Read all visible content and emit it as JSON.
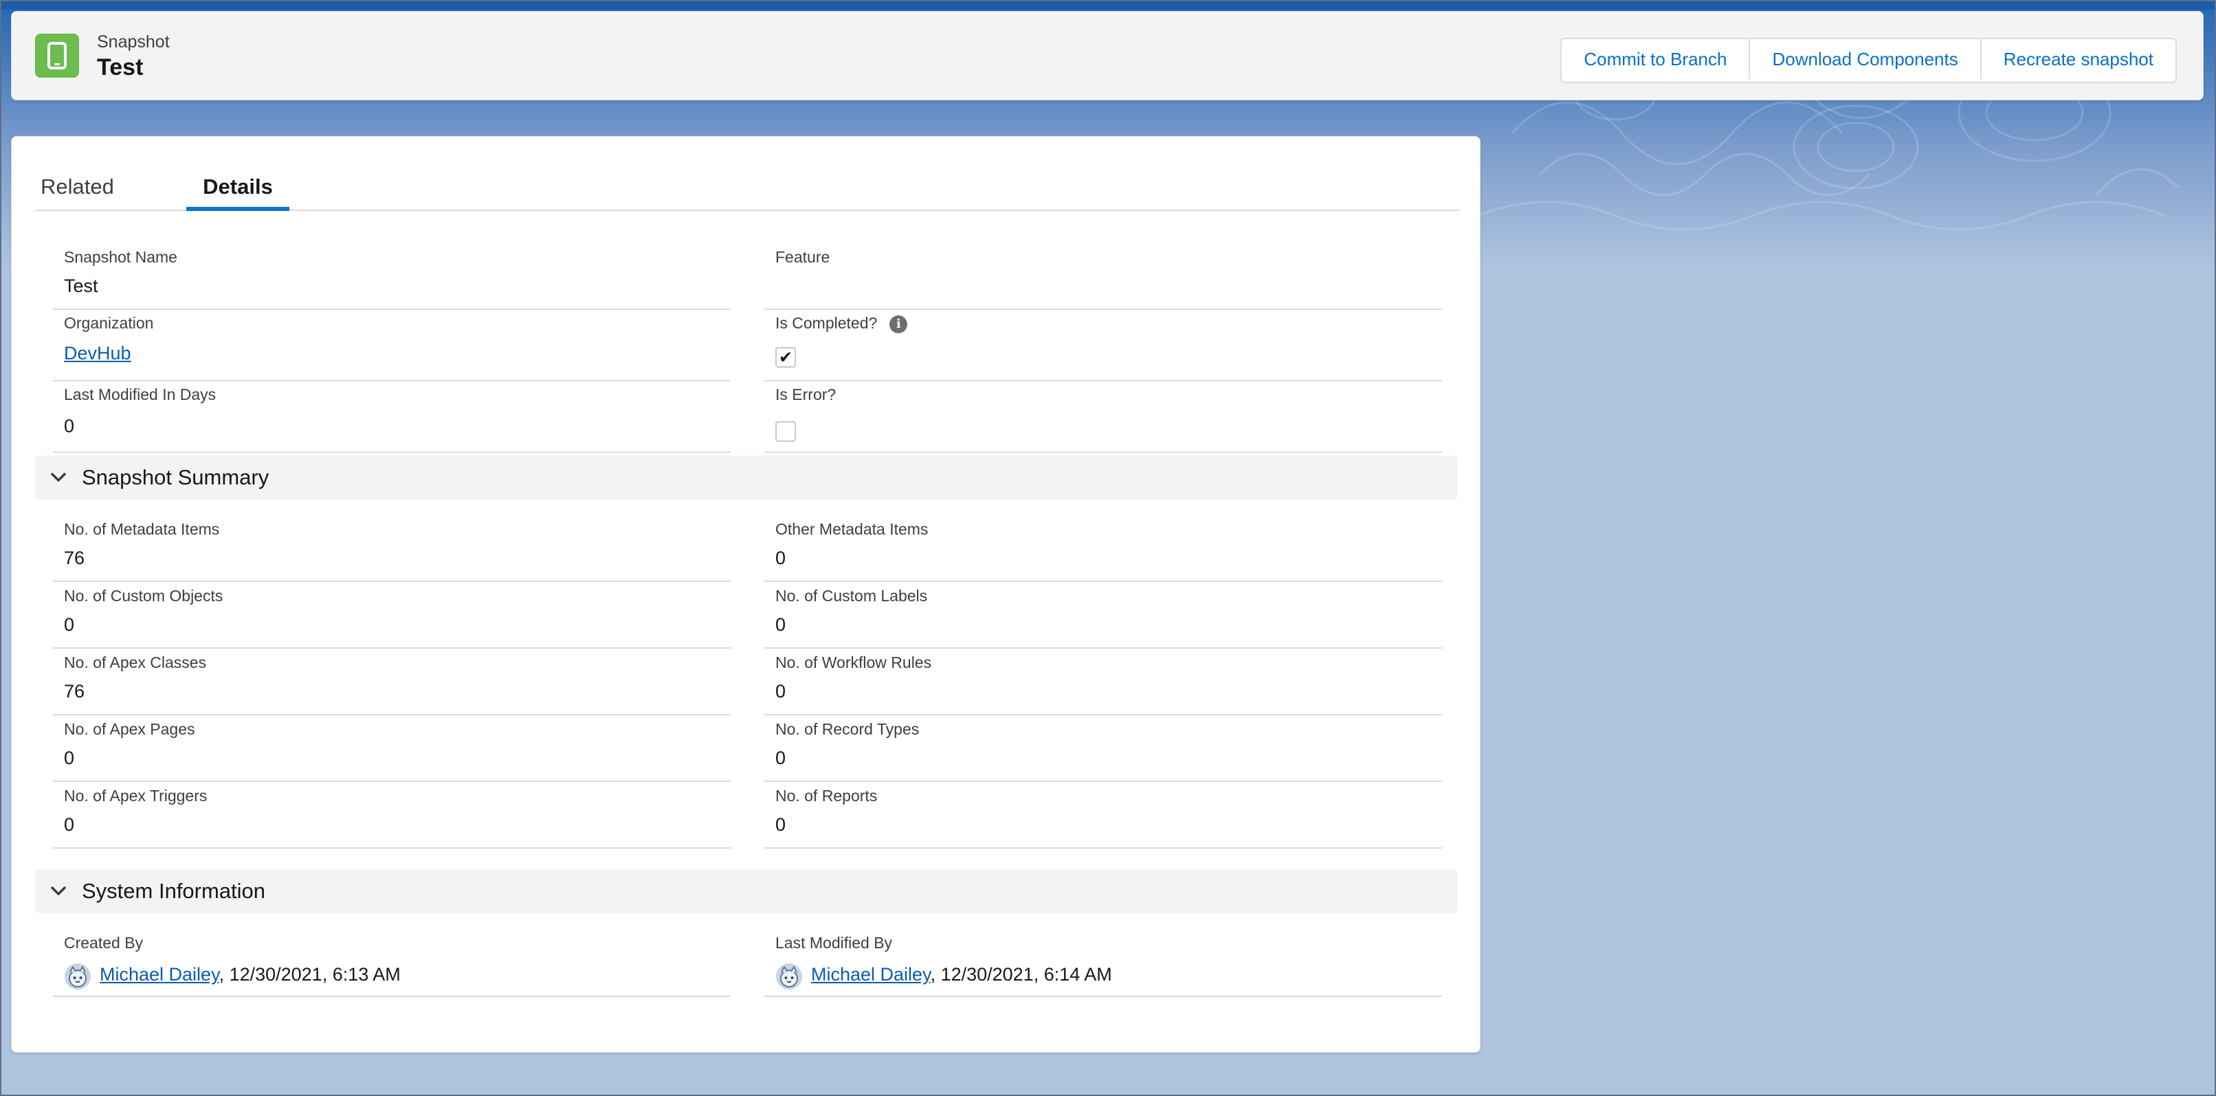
{
  "header": {
    "object_label": "Snapshot",
    "record_title": "Test",
    "icon": "mobile-device-icon",
    "buttons": [
      "Commit to Branch",
      "Download Components",
      "Recreate snapshot"
    ]
  },
  "tabs": [
    {
      "label": "Related",
      "active": false
    },
    {
      "label": "Details",
      "active": true
    }
  ],
  "details": {
    "snapshot_name": {
      "label": "Snapshot Name",
      "value": "Test"
    },
    "feature": {
      "label": "Feature",
      "value": ""
    },
    "organization": {
      "label": "Organization",
      "value": "DevHub"
    },
    "is_completed": {
      "label": "Is Completed?",
      "checked": true,
      "check_glyph": "✔",
      "info_glyph": "i"
    },
    "last_modified_days": {
      "label": "Last Modified In Days",
      "value": "0"
    },
    "is_error": {
      "label": "Is Error?",
      "checked": false
    }
  },
  "snapshot_summary": {
    "title": "Snapshot Summary",
    "fields": [
      {
        "label": "No. of Metadata Items",
        "value": "76"
      },
      {
        "label": "Other Metadata Items",
        "value": "0"
      },
      {
        "label": "No. of Custom Objects",
        "value": "0"
      },
      {
        "label": "No. of Custom Labels",
        "value": "0"
      },
      {
        "label": "No. of Apex Classes",
        "value": "76"
      },
      {
        "label": "No. of Workflow Rules",
        "value": "0"
      },
      {
        "label": "No. of Apex Pages",
        "value": "0"
      },
      {
        "label": "No. of Record Types",
        "value": "0"
      },
      {
        "label": "No. of Apex Triggers",
        "value": "0"
      },
      {
        "label": "No. of Reports",
        "value": "0"
      }
    ]
  },
  "system_information": {
    "title": "System Information",
    "created_by": {
      "label": "Created By",
      "user": "Michael Dailey",
      "datetime": ", 12/30/2021, 6:13 AM"
    },
    "last_modified_by": {
      "label": "Last Modified By",
      "user": "Michael Dailey",
      "datetime": ", 12/30/2021, 6:14 AM"
    }
  },
  "colors": {
    "accent": "#0176d3",
    "link": "#0b5cab",
    "icon_green": "#6bbd4d",
    "background": "#b0c4df"
  }
}
